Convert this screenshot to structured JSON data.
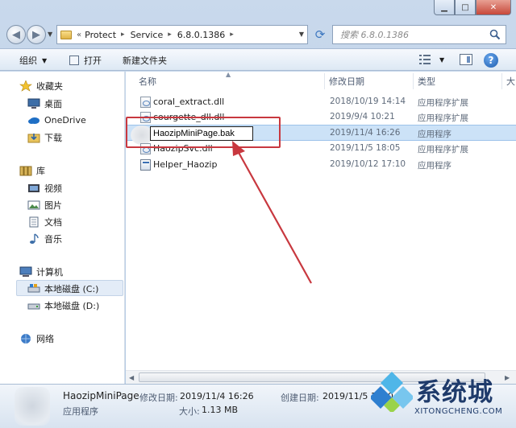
{
  "address": {
    "crumbs": [
      "Protect",
      "Service",
      "6.8.0.1386"
    ]
  },
  "search": {
    "placeholder": "搜索 6.8.0.1386"
  },
  "toolbar": {
    "organize": "组织",
    "open": "打开",
    "new_folder": "新建文件夹"
  },
  "nav": {
    "favorites": "收藏夹",
    "desktop": "桌面",
    "onedrive": "OneDrive",
    "downloads": "下载",
    "libraries": "库",
    "videos": "视频",
    "pictures": "图片",
    "documents": "文档",
    "music": "音乐",
    "computer": "计算机",
    "drive_c": "本地磁盘 (C:)",
    "drive_d": "本地磁盘 (D:)",
    "network": "网络"
  },
  "columns": {
    "name": "名称",
    "modified": "修改日期",
    "type": "类型",
    "extra": "大"
  },
  "files": [
    {
      "name": "coral_extract.dll",
      "modified": "2018/10/19 14:14",
      "type": "应用程序扩展",
      "icon": "dll-icon"
    },
    {
      "name": "courgette_dll.dll",
      "modified": "2019/9/4 10:21",
      "type": "应用程序扩展",
      "icon": "dll-icon"
    },
    {
      "name": "HaozipMiniPage.bak",
      "modified": "2019/11/4 16:26",
      "type": "应用程序",
      "icon": "app-icon",
      "renaming": true
    },
    {
      "name": "HaozipSvc.dll",
      "modified": "2019/11/5 18:05",
      "type": "应用程序扩展",
      "icon": "dll-icon"
    },
    {
      "name": "Helper_Haozip",
      "modified": "2019/10/12 17:10",
      "type": "应用程序",
      "icon": "app-icon"
    }
  ],
  "details": {
    "name": "HaozipMiniPage",
    "type": "应用程序",
    "modified_label": "修改日期:",
    "modified_value": "2019/11/4 16:26",
    "size_label": "大小:",
    "size_value": "1.13 MB",
    "created_label": "创建日期:",
    "created_value": "2019/11/5 1..00"
  },
  "watermark": {
    "title": "系统城",
    "subtitle": "XITONGCHENG.COM"
  },
  "colors": {
    "annotation": "#c8383f",
    "selection": "#cce2f7",
    "accent": "#1d5cad"
  }
}
